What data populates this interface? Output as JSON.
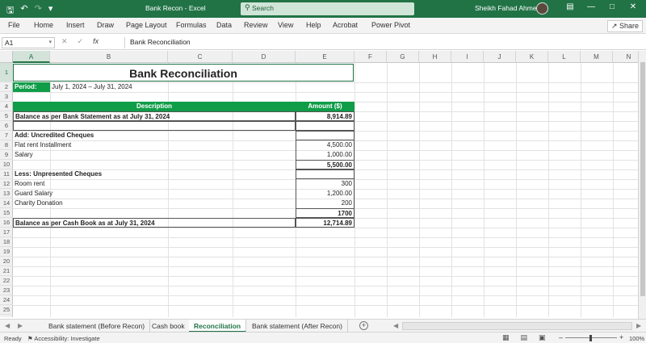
{
  "titlebar": {
    "doc_title": "Bank Recon",
    "separator": " - ",
    "app": "Excel",
    "search_placeholder": "Search",
    "user": "Sheikh Fahad Ahmed"
  },
  "ribbon": {
    "tabs": [
      "File",
      "Home",
      "Insert",
      "Draw",
      "Page Layout",
      "Formulas",
      "Data",
      "Review",
      "View",
      "Help",
      "Acrobat",
      "Power Pivot"
    ],
    "share": "Share"
  },
  "formula_bar": {
    "name_box": "A1",
    "fx": "fx",
    "value": "Bank Reconciliation"
  },
  "columns": [
    "A",
    "B",
    "C",
    "D",
    "E",
    "F",
    "G",
    "H",
    "I",
    "J",
    "K",
    "L",
    "M",
    "N"
  ],
  "rows": [
    "1",
    "2",
    "3",
    "4",
    "5",
    "6",
    "7",
    "8",
    "9",
    "10",
    "11",
    "12",
    "13",
    "14",
    "15",
    "16",
    "17",
    "18",
    "19",
    "20",
    "21",
    "22",
    "23",
    "24",
    "25"
  ],
  "sheet": {
    "title": "Bank Reconciliation",
    "period_label": "Period:",
    "period_value": "July 1, 2024 – July 31, 2024",
    "header_description": "Description",
    "header_amount": "Amount ($)",
    "r5_desc": "Balance as per Bank Statement as at July 31, 2024",
    "r5_amt": "8,914.89",
    "r7_desc": "Add: Uncredited Cheques",
    "r8_desc": "Flat rent Installment",
    "r8_amt": "4,500.00",
    "r9_desc": "Salary",
    "r9_amt": "1,000.00",
    "r10_amt": "5,500.00",
    "r11_desc": "Less: Unpresented Cheques",
    "r12_desc": "Room rent",
    "r12_amt": "300",
    "r13_desc": "Guard Salary",
    "r13_amt": "1,200.00",
    "r14_desc": "Charity Donation",
    "r14_amt": "200",
    "r15_amt": "1700",
    "r16_desc": "Balance as per Cash Book as at July 31, 2024",
    "r16_amt": "12,714.89"
  },
  "sheet_tabs": [
    "Bank statement (Before Recon)",
    "Cash book",
    "Reconciliation",
    "Bank statement (After Recon)"
  ],
  "active_sheet": "Reconciliation",
  "status": {
    "ready": "Ready",
    "accessibility": "Accessibility: Investigate",
    "zoom": "100%"
  },
  "colors": {
    "excel_green": "#217346",
    "header_fill": "#0f9d48"
  }
}
